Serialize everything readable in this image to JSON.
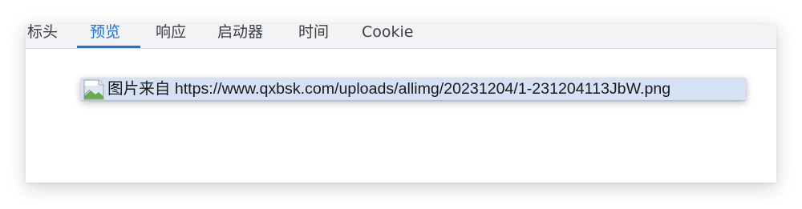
{
  "tabs": [
    {
      "label": "标头",
      "active": false
    },
    {
      "label": "预览",
      "active": true
    },
    {
      "label": "响应",
      "active": false
    },
    {
      "label": "启动器",
      "active": false
    },
    {
      "label": "时间",
      "active": false
    },
    {
      "label": "Cookie",
      "active": false
    }
  ],
  "preview": {
    "alt_text": "图片来自 https://www.qxbsk.com/uploads/allimg/20231204/1-231204113JbW.png",
    "icon": "broken-image-icon"
  },
  "colors": {
    "accent": "#1a73e8",
    "tab_bar_bg": "#f1f3f4",
    "selection_bg": "#d5e2f5",
    "text": "#3c4043"
  }
}
